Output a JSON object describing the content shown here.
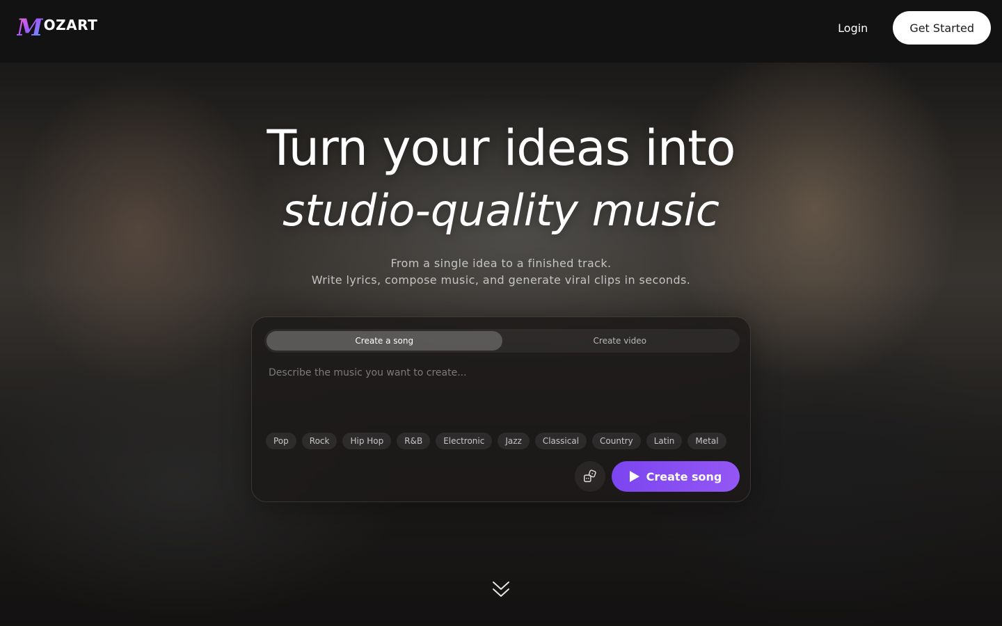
{
  "header": {
    "logo_initial": "M",
    "logo_rest": "OZART",
    "login_label": "Login",
    "get_started_label": "Get Started"
  },
  "hero": {
    "title": "Turn your ideas into",
    "title_italic": "studio-quality music",
    "subtitle_line1": "From a single idea to a finished track.",
    "subtitle_line2": "Write lyrics, compose music, and generate viral clips in seconds."
  },
  "composer": {
    "tabs": [
      {
        "label": "Create a song",
        "active": true
      },
      {
        "label": "Create video",
        "active": false
      }
    ],
    "prompt": {
      "placeholder": "Describe the music you want to create...",
      "value": ""
    },
    "genres": [
      "Pop",
      "Rock",
      "Hip Hop",
      "R&B",
      "Electronic",
      "Jazz",
      "Classical",
      "Country",
      "Latin",
      "Metal"
    ],
    "random_icon": "dice-icon",
    "create_label": "Create song",
    "create_icon": "play-icon"
  },
  "scroll_icon": "double-chevron-down-icon",
  "colors": {
    "accent": "#8b4ff3",
    "button_light": "#ffffff",
    "background": "#121212"
  }
}
